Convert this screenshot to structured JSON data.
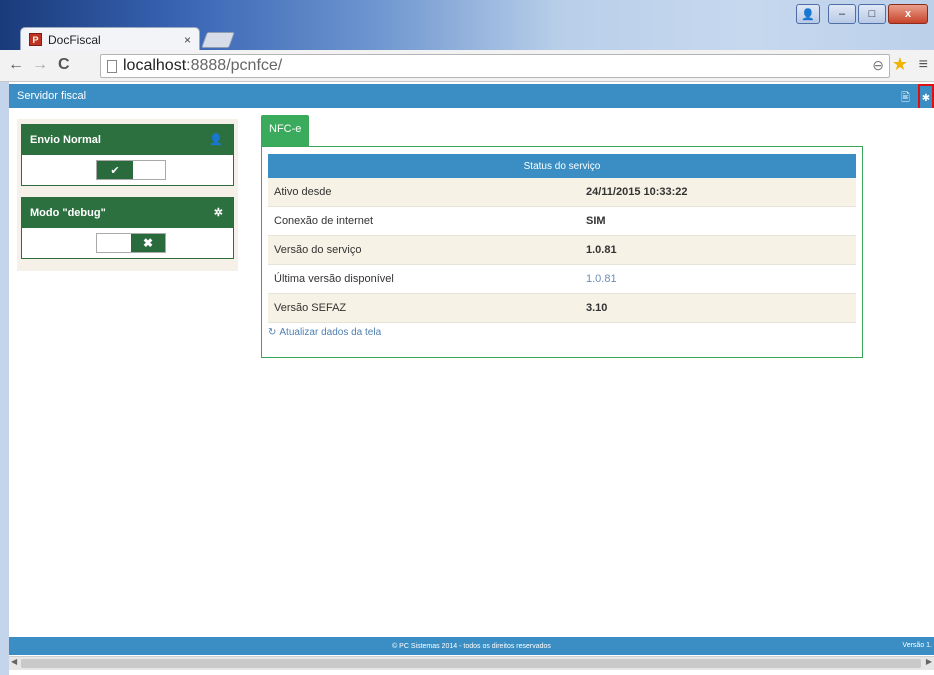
{
  "browser": {
    "tab_title": "DocFiscal",
    "tab_close": "×",
    "url_host": "localhost",
    "url_rest": ":8888/pcnfce/",
    "icons": [
      "back-arrow-icon",
      "forward-arrow-icon",
      "reload-icon",
      "page-icon",
      "zoom-icon",
      "star-icon",
      "menu-icon"
    ]
  },
  "window_buttons": {
    "minimize": "–",
    "maximize": "□",
    "close": "x",
    "user": "👤"
  },
  "app": {
    "header_title": "Servidor fiscal",
    "brand_color": "#3a8ec3"
  },
  "left_panel": {
    "cards": [
      {
        "title": "Envio Normal",
        "icon": "user-icon",
        "toggle_on": true
      },
      {
        "title": "Modo \"debug\"",
        "icon": "bug-icon",
        "toggle_on": false
      }
    ]
  },
  "nfce": {
    "tab_label": "NFC-e",
    "table_title": "Status do serviço",
    "rows": [
      {
        "label": "Ativo desde",
        "value": "24/11/2015 10:33:22"
      },
      {
        "label": "Conexão de internet",
        "value": "SIM"
      },
      {
        "label": "Versão do serviço",
        "value": "1.0.81"
      },
      {
        "label": "Última versão disponível",
        "value": "1.0.81"
      },
      {
        "label": "Versão SEFAZ",
        "value": "3.10"
      }
    ],
    "refresh_label": "Atualizar dados da tela"
  },
  "footer": {
    "copyright": "© PC Sistemas 2014 - todos os direitos reservados",
    "version": "Versão 1."
  }
}
